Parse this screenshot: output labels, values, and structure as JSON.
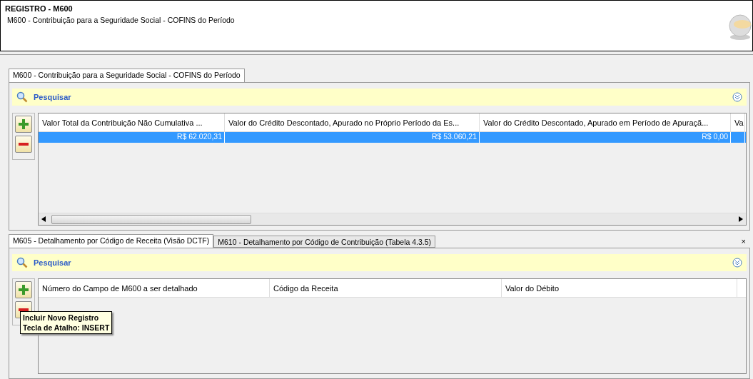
{
  "header": {
    "title": "REGISTRO - M600",
    "subtitle": "M600 - Contribuição para a Seguridade Social - COFINS do Período"
  },
  "top_tabs": [
    {
      "label": "M600 - Contribuição para a Seguridade Social - COFINS do Período",
      "selected": true
    }
  ],
  "top_search": {
    "label": "Pesquisar"
  },
  "top_table": {
    "columns": [
      "Valor Total da Contribuição Não Cumulativa ...",
      "Valor do Crédito Descontado, Apurado no Próprio Período da Es...",
      "Valor do Crédito Descontado, Apurado em Período de Apuraçã...",
      "Va"
    ],
    "rows": [
      {
        "selected": true,
        "cells": [
          "R$ 62.020,31",
          "R$ 53.060,21",
          "R$ 0,00",
          ""
        ]
      }
    ]
  },
  "bottom_tabs": [
    {
      "label": "M605 - Detalhamento por Código de Receita (Visão DCTF)",
      "selected": true
    },
    {
      "label": "M610 - Detalhamento por Código de Contribuição (Tabela 4.3.5)",
      "selected": false
    }
  ],
  "close_label": "×",
  "bottom_search": {
    "label": "Pesquisar"
  },
  "bottom_table": {
    "columns": [
      "Número do Campo de M600 a ser detalhado",
      "Código da Receita",
      "Valor do Débito"
    ]
  },
  "tooltip": {
    "lines": [
      "Incluir Novo Registro",
      "Tecla de Atalho: INSERT"
    ]
  }
}
